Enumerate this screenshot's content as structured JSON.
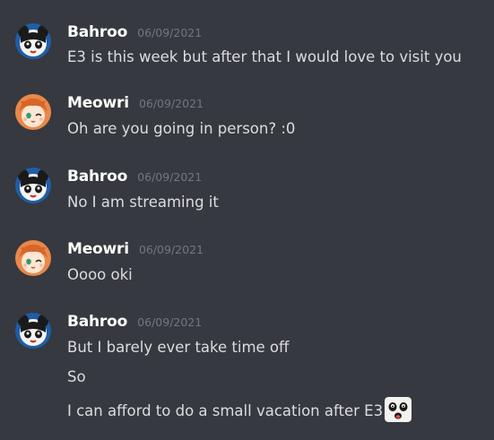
{
  "messages": [
    {
      "author": "Bahroo",
      "avatar_icon": "panda-avatar-icon",
      "timestamp": "06/09/2021",
      "lines": [
        "E3 is this week but after that I would love to visit you"
      ]
    },
    {
      "author": "Meowri",
      "avatar_icon": "catgirl-avatar-icon",
      "timestamp": "06/09/2021",
      "lines": [
        "Oh are you going in person? :0"
      ]
    },
    {
      "author": "Bahroo",
      "avatar_icon": "panda-avatar-icon",
      "timestamp": "06/09/2021",
      "lines": [
        "No I am streaming it"
      ]
    },
    {
      "author": "Meowri",
      "avatar_icon": "catgirl-avatar-icon",
      "timestamp": "06/09/2021",
      "lines": [
        "Oooo oki"
      ]
    },
    {
      "author": "Bahroo",
      "avatar_icon": "panda-avatar-icon",
      "timestamp": "06/09/2021",
      "lines": [
        "But I barely ever take time off",
        "So",
        "I can afford to do a small vacation after E3"
      ],
      "trailing_emoji": "panda-face-emoji-icon"
    }
  ],
  "colors": {
    "background": "#36393f",
    "username": "#ffffff",
    "timestamp": "#72767d",
    "message_text": "#dcddde"
  }
}
